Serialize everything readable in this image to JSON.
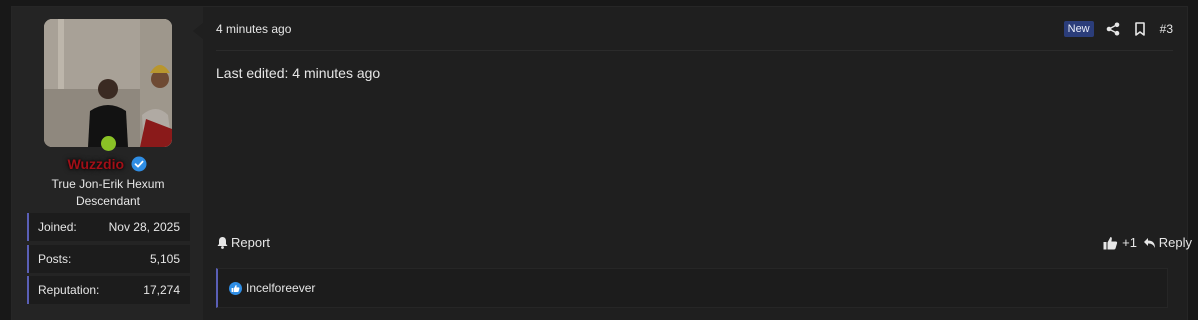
{
  "user": {
    "username": "Wuzzdio",
    "title": "True Jon-Erik Hexum Descendant",
    "stats": [
      {
        "label": "Joined:",
        "value": "Nov 28, 2025"
      },
      {
        "label": "Posts:",
        "value": "5,105"
      },
      {
        "label": "Reputation:",
        "value": "17,274"
      }
    ],
    "online": true,
    "username_color": "#a10f17"
  },
  "post": {
    "time": "4 minutes ago",
    "badge": "New",
    "number": "#3",
    "body": "Last edited: 4 minutes ago",
    "report_label": "Report",
    "like_count": "+1",
    "reply_label": "Reply",
    "reacted_user": "Incelforeever"
  },
  "icons": {
    "share": "share-icon",
    "bookmark": "bookmark-icon",
    "report": "bell-icon",
    "like": "thumbs-up-icon",
    "reply": "reply-icon",
    "verified": "verified-badge-icon"
  },
  "colors": {
    "accent": "#5a5fb6",
    "badge_bg": "#2b3d7a",
    "online": "#8ac226",
    "reaction_blue": "#2f8ee5"
  }
}
